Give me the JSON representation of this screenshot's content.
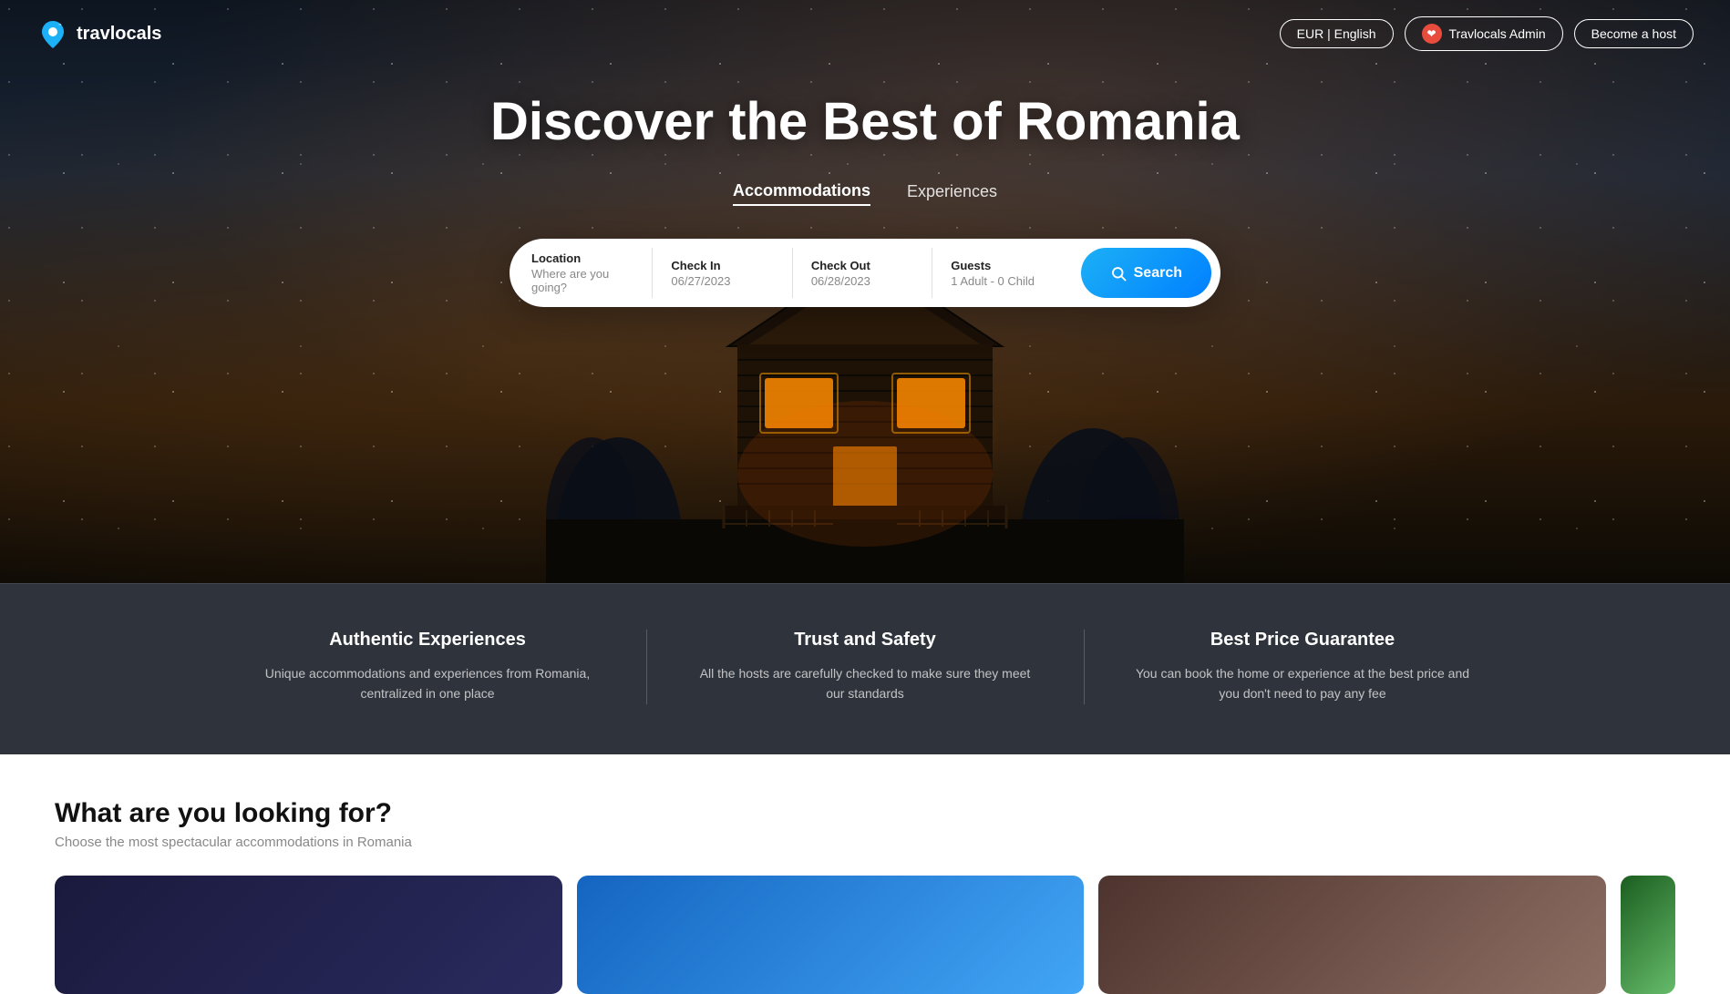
{
  "header": {
    "logo_text": "travlocals",
    "currency_lang_label": "EUR | English",
    "user_label": "Travlocals Admin",
    "become_host_label": "Become a host"
  },
  "hero": {
    "title": "Discover the Best of Romania",
    "tabs": [
      {
        "id": "accommodations",
        "label": "Accommodations",
        "active": true
      },
      {
        "id": "experiences",
        "label": "Experiences",
        "active": false
      }
    ]
  },
  "search": {
    "location_label": "Location",
    "location_placeholder": "Where are you going?",
    "checkin_label": "Check In",
    "checkin_value": "06/27/2023",
    "checkout_label": "Check Out",
    "checkout_value": "06/28/2023",
    "guests_label": "Guests",
    "guests_value": "1 Adult - 0 Child",
    "search_button_label": "Search"
  },
  "features": [
    {
      "title": "Authentic Experiences",
      "description": "Unique accommodations and experiences from Romania, centralized in one place"
    },
    {
      "title": "Trust and Safety",
      "description": "All the hosts are carefully checked to make sure they meet our standards"
    },
    {
      "title": "Best Price Guarantee",
      "description": "You can book the home or experience at the best price and you don't need to pay any fee"
    }
  ],
  "lower": {
    "title": "What are you looking for?",
    "subtitle": "Choose the most spectacular accommodations in Romania"
  }
}
